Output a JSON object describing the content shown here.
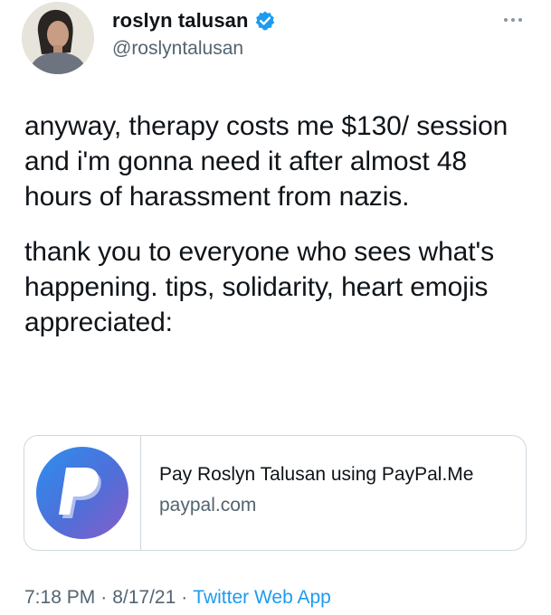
{
  "author": {
    "display_name": "roslyn talusan",
    "handle": "@roslyntalusan",
    "verified_icon": "verified-badge-icon",
    "verified_color": "#1d9bf0"
  },
  "more_icon": "more-horizontal-icon",
  "tweet": {
    "paragraphs": [
      "anyway, therapy costs me $130/ session and i'm gonna need it after almost 48 hours of harassment from nazis.",
      "thank you to everyone who sees what's happening. tips, solidarity, heart emojis appreciated:"
    ]
  },
  "link_card": {
    "title": "Pay Roslyn Talusan using PayPal.Me",
    "domain": "paypal.com",
    "thumbnail_icon": "paypal-logo-icon"
  },
  "meta": {
    "time": "7:18 PM",
    "separator": "·",
    "date": "8/17/21",
    "source": "Twitter Web App",
    "source_color": "#1d9bf0"
  }
}
